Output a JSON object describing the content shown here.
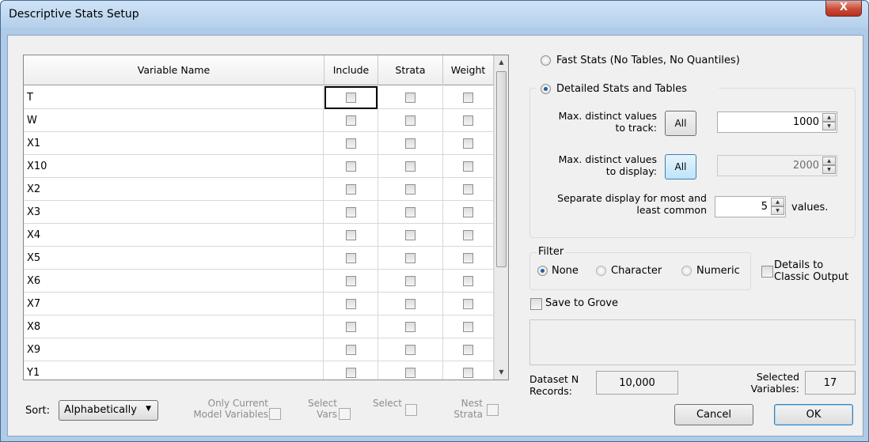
{
  "window": {
    "title": "Descriptive Stats Setup",
    "close_label": "X"
  },
  "grid": {
    "headers": {
      "name": "Variable Name",
      "include": "Include",
      "strata": "Strata",
      "weight": "Weight"
    },
    "rows": [
      "T",
      "W",
      "X1",
      "X10",
      "X2",
      "X3",
      "X4",
      "X5",
      "X6",
      "X7",
      "X8",
      "X9",
      "Y1"
    ]
  },
  "bottom": {
    "sort_label": "Sort:",
    "sort_value": "Alphabetically",
    "only_current_line1": "Only Current",
    "only_current_line2": "Model Variables",
    "select_vars_line1": "Select",
    "select_vars_line2": "Vars",
    "select_label": "Select",
    "nest_strata_line1": "Nest",
    "nest_strata_line2": "Strata"
  },
  "mode": {
    "fast_label": "Fast Stats (No Tables, No Quantiles)",
    "detailed_label": "Detailed Stats and Tables",
    "selected": "detailed"
  },
  "detailed": {
    "track_line1": "Max. distinct values",
    "track_line2": "to track:",
    "track_button": "All",
    "track_value": "1000",
    "display_line1": "Max. distinct values",
    "display_line2": "to display:",
    "display_button": "All",
    "display_value": "2000",
    "separate_line1": "Separate display for most and",
    "separate_line2": "least common",
    "separate_value": "5",
    "values_label": "values."
  },
  "filter": {
    "title": "Filter",
    "none_label": "None",
    "character_label": "Character",
    "numeric_label": "Numeric",
    "selected": "none",
    "details_line1": "Details to",
    "details_line2": "Classic Output"
  },
  "save_to_grove_label": "Save to Grove",
  "stats": {
    "dataset_line1": "Dataset N",
    "dataset_line2": "Records:",
    "dataset_value": "10,000",
    "selected_line1": "Selected",
    "selected_line2": "Variables:",
    "selected_value": "17"
  },
  "buttons": {
    "cancel": "Cancel",
    "ok": "OK"
  },
  "colors": {
    "titlebar": "#b5d0ec",
    "frame": "#aecbe8",
    "close": "#c94a37",
    "radio_dot": "#1f5fa8"
  }
}
